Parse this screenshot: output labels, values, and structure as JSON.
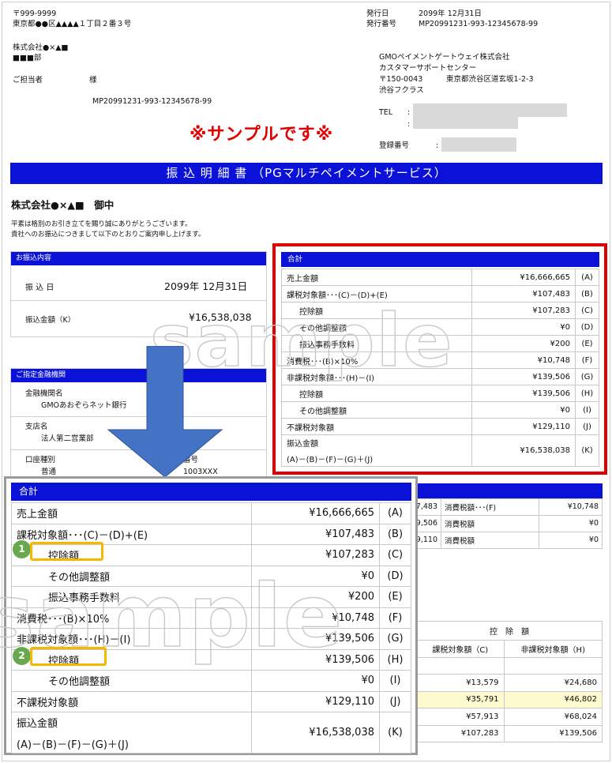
{
  "recipient": {
    "postal": "〒999-9999",
    "address": "東京都●●区▲▲▲▲１丁目２番３号",
    "company": "株式会社●×▲■",
    "department": "■■■部",
    "person_label": "ご担当者",
    "honorific": "様",
    "doc_id": "MP20991231-993-12345678-99"
  },
  "issue": {
    "date_label": "発行日",
    "date_value": "2099年  12月31日",
    "no_label": "発行番号",
    "no_value": "MP20991231-993-12345678-99"
  },
  "sender": {
    "name": "GMOペイメントゲートウェイ株式会社",
    "center": "カスタマーサポートセンター",
    "postal": "〒150-0043",
    "address": "東京都渋谷区道玄坂1-2-3",
    "building": "渋谷フクラス",
    "tel_label": "TEL",
    "colon": ":",
    "reg_label": "登録番号"
  },
  "sample_text": "※サンプルです※",
  "title": "振 込 明 細 書  （PGマルチペイメントサービス）",
  "addressee": "株式会社●×▲■　御中",
  "greeting": [
    "平素は格別のお引き立てを賜り誠にありがとうございます。",
    "貴社へのお振込につきまして以下のとおりご案内申し上げます。"
  ],
  "transfer": {
    "header": "お振込内容",
    "date_label": "振 込 日",
    "date_value": "2099年  12月31日",
    "amount_label": "振込金額（K）",
    "amount_value": "¥16,538,038"
  },
  "bank": {
    "header": "ご指定金融機関",
    "name_label": "金融機関名",
    "name_value": "GMOあおぞらネット銀行",
    "branch_label": "支店名",
    "branch_value": "法人第二営業部",
    "type_label": "口座種別",
    "type_value": "普通",
    "acct_label": "番号",
    "acct_value": "1003XXX"
  },
  "total": {
    "header": "合計",
    "rows": [
      {
        "label": "売上金額",
        "value": "¥16,666,665",
        "code": "(A)",
        "indent": false
      },
      {
        "label": "課税対象額･･･(C)－(D)+(E)",
        "value": "¥107,483",
        "code": "(B)",
        "indent": false
      },
      {
        "label": "控除額",
        "value": "¥107,283",
        "code": "(C)",
        "indent": true
      },
      {
        "label": "その他調整額",
        "value": "¥0",
        "code": "(D)",
        "indent": true
      },
      {
        "label": "振込事務手数料",
        "value": "¥200",
        "code": "(E)",
        "indent": true
      },
      {
        "label": "消費税･･･(B)×10%",
        "value": "¥10,748",
        "code": "(F)",
        "indent": false
      },
      {
        "label": "非課税対象額･･･(H)－(I)",
        "value": "¥139,506",
        "code": "(G)",
        "indent": false
      },
      {
        "label": "控除額",
        "value": "¥139,506",
        "code": "(H)",
        "indent": true
      },
      {
        "label": "その他調整額",
        "value": "¥0",
        "code": "(I)",
        "indent": true
      },
      {
        "label": "不課税対象額",
        "value": "¥129,110",
        "code": "(J)",
        "indent": false
      }
    ],
    "last_label_1": "振込金額",
    "last_label_2": "(A)－(B)－(F)－(G)＋(J)",
    "last_value": "¥16,538,038",
    "last_code": "(K)"
  },
  "badges": [
    "1",
    "2"
  ],
  "watermark": "sample",
  "tax_mini": {
    "rows": [
      {
        "c1": "7,483",
        "c2": "消費税額･･･(F)",
        "c3": "¥10,748"
      },
      {
        "c1": "9,506",
        "c2": "消費税額",
        "c3": "¥0"
      },
      {
        "c1": "9,110",
        "c2": "消費税額",
        "c3": "¥0"
      }
    ]
  },
  "deduction": {
    "header": "控　除　額",
    "col1": "課税対象額（C)",
    "col2": "非課税対象額（H)",
    "rows": [
      {
        "a": "",
        "b": ""
      },
      {
        "a": "¥13,579",
        "b": "¥24,680"
      },
      {
        "a": "¥35,791",
        "b": "¥46,802"
      },
      {
        "a": "¥57,913",
        "b": "¥68,024"
      },
      {
        "a": "¥107,283",
        "b": "¥139,506"
      }
    ]
  },
  "colors": {
    "bar": "#0b12d8",
    "highlight_red": "#e00000",
    "badge_green": "#6aa84f",
    "badge_box": "#f5b800",
    "arrow": "#4472c4",
    "yellow_row": "#fdfad0"
  }
}
